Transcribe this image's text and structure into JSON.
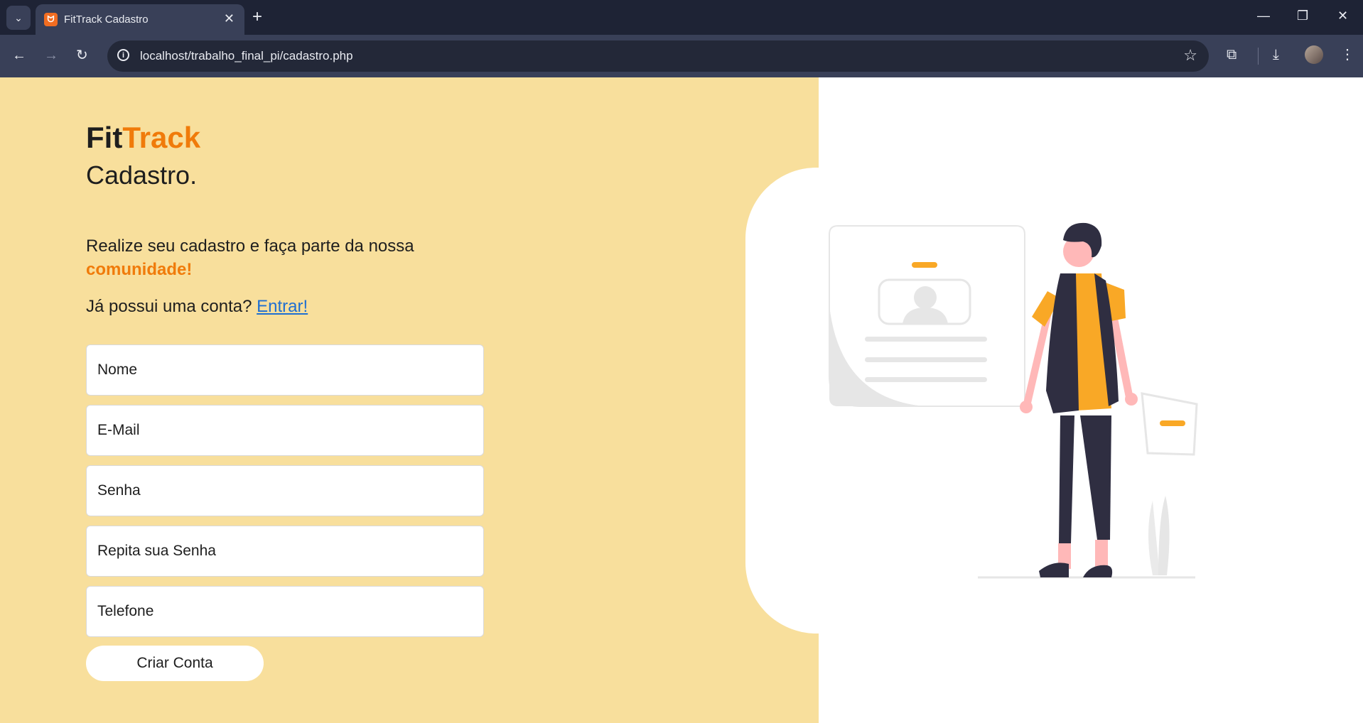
{
  "browser": {
    "tab_title": "FitTrack Cadastro",
    "url": "localhost/trabalho_final_pi/cadastro.php"
  },
  "brand": {
    "part1": "Fit",
    "part2": "Track"
  },
  "page": {
    "subtitle": "Cadastro.",
    "description": "Realize seu cadastro e faça parte da nossa",
    "highlight": "comunidade!",
    "login_prompt": "Já possui uma conta?",
    "login_link": "Entrar!"
  },
  "form": {
    "name_placeholder": "Nome",
    "email_placeholder": "E-Mail",
    "password_placeholder": "Senha",
    "repeat_password_placeholder": "Repita sua Senha",
    "phone_placeholder": "Telefone",
    "submit_label": "Criar Conta"
  },
  "colors": {
    "left_panel": "#f8df9c",
    "accent": "#f07b0a",
    "link": "#1f6fd1",
    "illustration_accent": "#f9a826"
  }
}
